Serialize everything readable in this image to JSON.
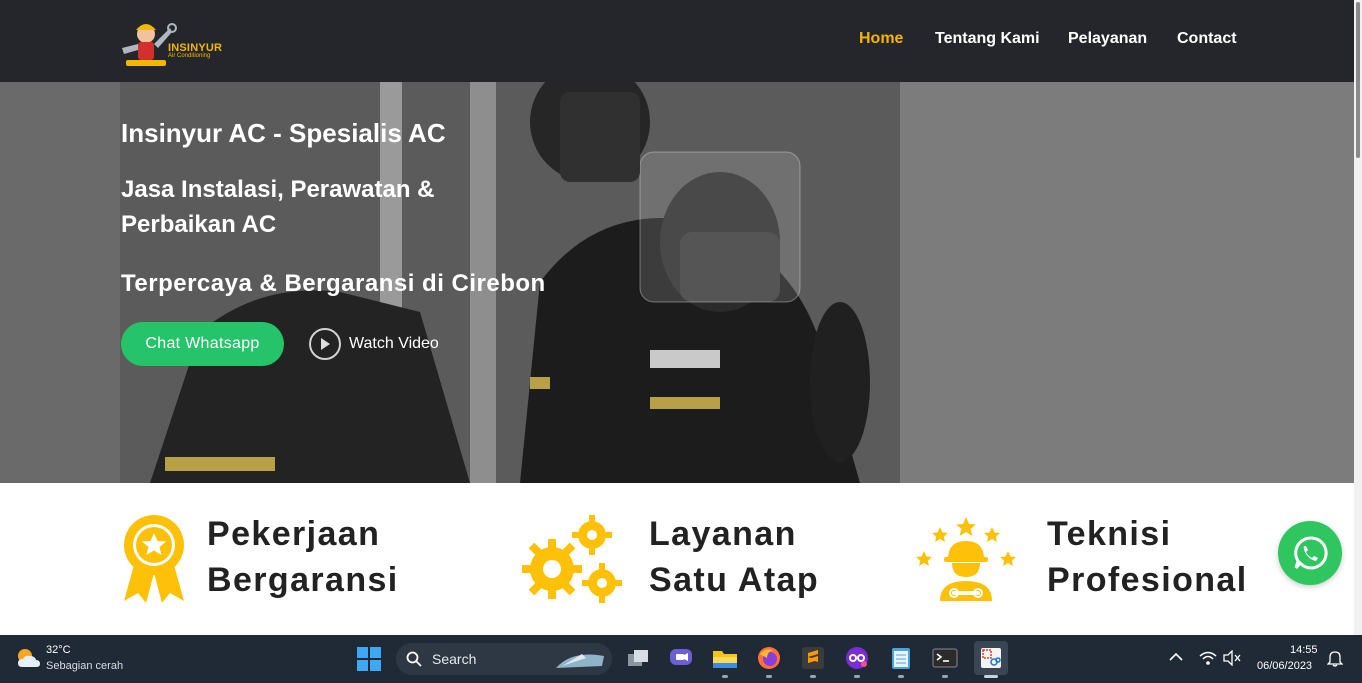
{
  "navbar": {
    "logo_text": "INSINYUR",
    "logo_sub": "Air Conditioning",
    "links": [
      {
        "label": "Home",
        "active": true
      },
      {
        "label": "Tentang Kami",
        "active": false
      },
      {
        "label": "Pelayanan",
        "active": false
      },
      {
        "label": "Contact",
        "active": false
      }
    ]
  },
  "hero": {
    "title": "Insinyur AC - Spesialis AC",
    "subtitle_line1": "Jasa Instalasi, Perawatan &",
    "subtitle_line2": "Perbaikan AC",
    "tagline": "Terpercaya & Bergaransi di Cirebon",
    "primary_button": "Chat Whatsapp",
    "video_link": "Watch Video"
  },
  "features": [
    {
      "icon": "award-ribbon-icon",
      "line1": "Pekerjaan",
      "line2": "Bergaransi"
    },
    {
      "icon": "gears-icon",
      "line1": "Layanan",
      "line2": "Satu Atap"
    },
    {
      "icon": "technician-stars-icon",
      "line1": "Teknisi",
      "line2": "Profesional"
    }
  ],
  "colors": {
    "accent": "#f5b400",
    "whatsapp": "#26c46a",
    "navbar_bg": "#24262b",
    "icon_yellow": "#ffc107"
  },
  "taskbar": {
    "weather_temp": "32°C",
    "weather_desc": "Sebagian cerah",
    "search_label": "Search",
    "time": "14:55",
    "date": "06/06/2023"
  }
}
